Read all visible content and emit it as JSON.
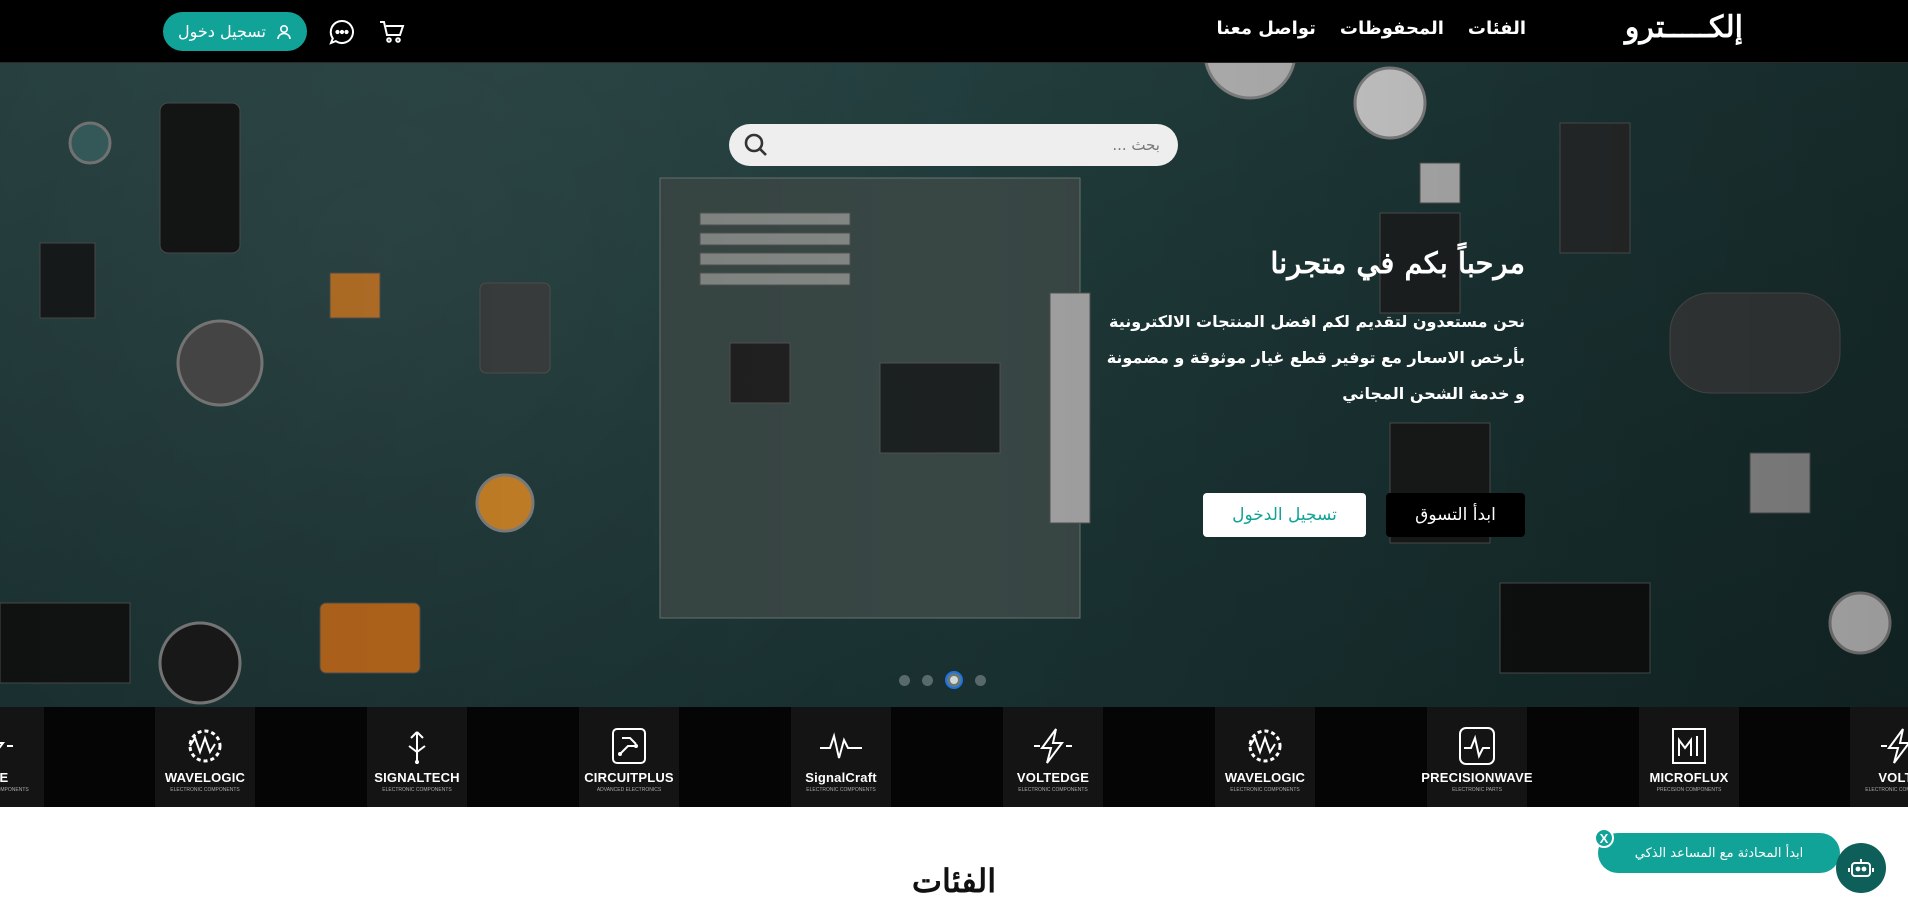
{
  "header": {
    "logo": "إلكـــــترو",
    "nav": [
      "الفئات",
      "المحفوظات",
      "تواصل معنا"
    ],
    "login_label": "تسجيل دخول",
    "icons": [
      "user-icon",
      "chat-icon",
      "cart-icon"
    ]
  },
  "hero": {
    "search_placeholder": "بحث ...",
    "title": "مرحباً بكم في متجرنا",
    "desc_line1": "نحن مستعدون لتقديم لكم افضل المنتجات الالكترونية",
    "desc_line2": "بأرخص الاسعار مع توفير قطع غيار موثوقة و مضمونة",
    "desc_line3": "و خدمة الشحن المجاني",
    "shop_label": "ابدأ التسوق",
    "login_label": "تسجيل الدخول",
    "slides": 4,
    "active_slide": 3
  },
  "brands": [
    {
      "name": "DGE",
      "sub": "ELECTRONIC COMPONENTS",
      "icon": "bolt-icon"
    },
    {
      "name": "WAVELOGIC",
      "sub": "ELECTRONIC COMPONENTS",
      "icon": "wave-gear-icon"
    },
    {
      "name": "SIGNALTECH",
      "sub": "ELECTRONIC COMPONENTS",
      "icon": "antenna-icon"
    },
    {
      "name": "CIRCUITPLUS",
      "sub": "ADVANCED ELECTRONICS",
      "icon": "circuit-icon"
    },
    {
      "name": "SignalCraft",
      "sub": "ELECTRONIC COMPONENTS",
      "icon": "signal-wave-icon"
    },
    {
      "name": "VOLTEDGE",
      "sub": "ELECTRONIC COMPONENTS",
      "icon": "bolt-icon"
    },
    {
      "name": "WAVELOGIC",
      "sub": "ELECTRONIC COMPONENTS",
      "icon": "wave-gear-icon"
    },
    {
      "name": "PRECISIONWAVE",
      "sub": "ELECTRONIC PARTS",
      "icon": "oscilloscope-icon"
    },
    {
      "name": "MICROFLUX",
      "sub": "PRECISION COMPONENTS",
      "icon": "chip-icon"
    },
    {
      "name": "VOLTE",
      "sub": "ELECTRONIC COMPONENTS",
      "icon": "bolt-icon"
    }
  ],
  "categories": {
    "title": "الفئات"
  },
  "chat": {
    "start_label": "ابدأ المحادثة مع المساعد الذكي",
    "close_label": "X"
  },
  "colors": {
    "accent": "#12a398",
    "topbar": "#000000",
    "hero_base": "#223d3d"
  }
}
